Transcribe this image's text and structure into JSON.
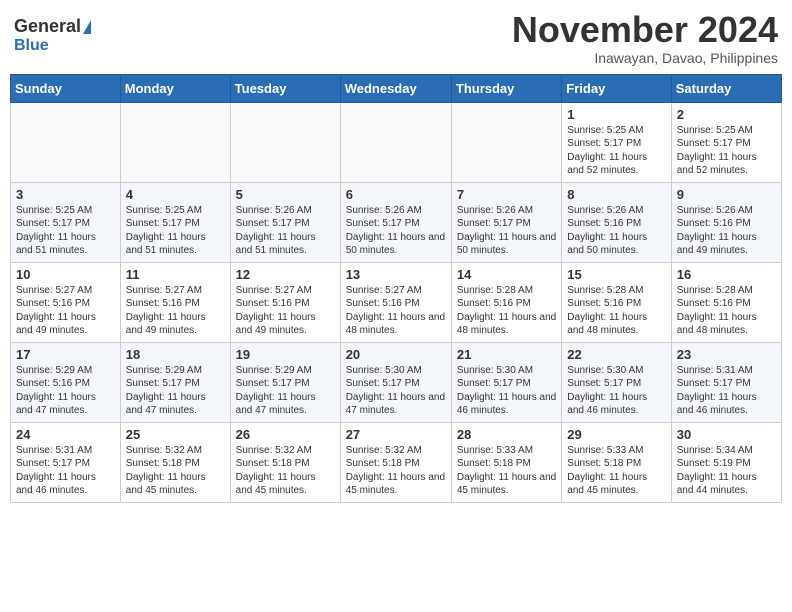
{
  "logo": {
    "general": "General",
    "blue": "Blue"
  },
  "title": "November 2024",
  "location": "Inawayan, Davao, Philippines",
  "days_of_week": [
    "Sunday",
    "Monday",
    "Tuesday",
    "Wednesday",
    "Thursday",
    "Friday",
    "Saturday"
  ],
  "weeks": [
    {
      "days": [
        {
          "num": "",
          "empty": true
        },
        {
          "num": "",
          "empty": true
        },
        {
          "num": "",
          "empty": true
        },
        {
          "num": "",
          "empty": true
        },
        {
          "num": "",
          "empty": true
        },
        {
          "num": "1",
          "sunrise": "Sunrise: 5:25 AM",
          "sunset": "Sunset: 5:17 PM",
          "daylight": "Daylight: 11 hours and 52 minutes."
        },
        {
          "num": "2",
          "sunrise": "Sunrise: 5:25 AM",
          "sunset": "Sunset: 5:17 PM",
          "daylight": "Daylight: 11 hours and 52 minutes."
        }
      ]
    },
    {
      "days": [
        {
          "num": "3",
          "sunrise": "Sunrise: 5:25 AM",
          "sunset": "Sunset: 5:17 PM",
          "daylight": "Daylight: 11 hours and 51 minutes."
        },
        {
          "num": "4",
          "sunrise": "Sunrise: 5:25 AM",
          "sunset": "Sunset: 5:17 PM",
          "daylight": "Daylight: 11 hours and 51 minutes."
        },
        {
          "num": "5",
          "sunrise": "Sunrise: 5:26 AM",
          "sunset": "Sunset: 5:17 PM",
          "daylight": "Daylight: 11 hours and 51 minutes."
        },
        {
          "num": "6",
          "sunrise": "Sunrise: 5:26 AM",
          "sunset": "Sunset: 5:17 PM",
          "daylight": "Daylight: 11 hours and 50 minutes."
        },
        {
          "num": "7",
          "sunrise": "Sunrise: 5:26 AM",
          "sunset": "Sunset: 5:17 PM",
          "daylight": "Daylight: 11 hours and 50 minutes."
        },
        {
          "num": "8",
          "sunrise": "Sunrise: 5:26 AM",
          "sunset": "Sunset: 5:16 PM",
          "daylight": "Daylight: 11 hours and 50 minutes."
        },
        {
          "num": "9",
          "sunrise": "Sunrise: 5:26 AM",
          "sunset": "Sunset: 5:16 PM",
          "daylight": "Daylight: 11 hours and 49 minutes."
        }
      ]
    },
    {
      "days": [
        {
          "num": "10",
          "sunrise": "Sunrise: 5:27 AM",
          "sunset": "Sunset: 5:16 PM",
          "daylight": "Daylight: 11 hours and 49 minutes."
        },
        {
          "num": "11",
          "sunrise": "Sunrise: 5:27 AM",
          "sunset": "Sunset: 5:16 PM",
          "daylight": "Daylight: 11 hours and 49 minutes."
        },
        {
          "num": "12",
          "sunrise": "Sunrise: 5:27 AM",
          "sunset": "Sunset: 5:16 PM",
          "daylight": "Daylight: 11 hours and 49 minutes."
        },
        {
          "num": "13",
          "sunrise": "Sunrise: 5:27 AM",
          "sunset": "Sunset: 5:16 PM",
          "daylight": "Daylight: 11 hours and 48 minutes."
        },
        {
          "num": "14",
          "sunrise": "Sunrise: 5:28 AM",
          "sunset": "Sunset: 5:16 PM",
          "daylight": "Daylight: 11 hours and 48 minutes."
        },
        {
          "num": "15",
          "sunrise": "Sunrise: 5:28 AM",
          "sunset": "Sunset: 5:16 PM",
          "daylight": "Daylight: 11 hours and 48 minutes."
        },
        {
          "num": "16",
          "sunrise": "Sunrise: 5:28 AM",
          "sunset": "Sunset: 5:16 PM",
          "daylight": "Daylight: 11 hours and 48 minutes."
        }
      ]
    },
    {
      "days": [
        {
          "num": "17",
          "sunrise": "Sunrise: 5:29 AM",
          "sunset": "Sunset: 5:16 PM",
          "daylight": "Daylight: 11 hours and 47 minutes."
        },
        {
          "num": "18",
          "sunrise": "Sunrise: 5:29 AM",
          "sunset": "Sunset: 5:17 PM",
          "daylight": "Daylight: 11 hours and 47 minutes."
        },
        {
          "num": "19",
          "sunrise": "Sunrise: 5:29 AM",
          "sunset": "Sunset: 5:17 PM",
          "daylight": "Daylight: 11 hours and 47 minutes."
        },
        {
          "num": "20",
          "sunrise": "Sunrise: 5:30 AM",
          "sunset": "Sunset: 5:17 PM",
          "daylight": "Daylight: 11 hours and 47 minutes."
        },
        {
          "num": "21",
          "sunrise": "Sunrise: 5:30 AM",
          "sunset": "Sunset: 5:17 PM",
          "daylight": "Daylight: 11 hours and 46 minutes."
        },
        {
          "num": "22",
          "sunrise": "Sunrise: 5:30 AM",
          "sunset": "Sunset: 5:17 PM",
          "daylight": "Daylight: 11 hours and 46 minutes."
        },
        {
          "num": "23",
          "sunrise": "Sunrise: 5:31 AM",
          "sunset": "Sunset: 5:17 PM",
          "daylight": "Daylight: 11 hours and 46 minutes."
        }
      ]
    },
    {
      "days": [
        {
          "num": "24",
          "sunrise": "Sunrise: 5:31 AM",
          "sunset": "Sunset: 5:17 PM",
          "daylight": "Daylight: 11 hours and 46 minutes."
        },
        {
          "num": "25",
          "sunrise": "Sunrise: 5:32 AM",
          "sunset": "Sunset: 5:18 PM",
          "daylight": "Daylight: 11 hours and 45 minutes."
        },
        {
          "num": "26",
          "sunrise": "Sunrise: 5:32 AM",
          "sunset": "Sunset: 5:18 PM",
          "daylight": "Daylight: 11 hours and 45 minutes."
        },
        {
          "num": "27",
          "sunrise": "Sunrise: 5:32 AM",
          "sunset": "Sunset: 5:18 PM",
          "daylight": "Daylight: 11 hours and 45 minutes."
        },
        {
          "num": "28",
          "sunrise": "Sunrise: 5:33 AM",
          "sunset": "Sunset: 5:18 PM",
          "daylight": "Daylight: 11 hours and 45 minutes."
        },
        {
          "num": "29",
          "sunrise": "Sunrise: 5:33 AM",
          "sunset": "Sunset: 5:18 PM",
          "daylight": "Daylight: 11 hours and 45 minutes."
        },
        {
          "num": "30",
          "sunrise": "Sunrise: 5:34 AM",
          "sunset": "Sunset: 5:19 PM",
          "daylight": "Daylight: 11 hours and 44 minutes."
        }
      ]
    }
  ]
}
